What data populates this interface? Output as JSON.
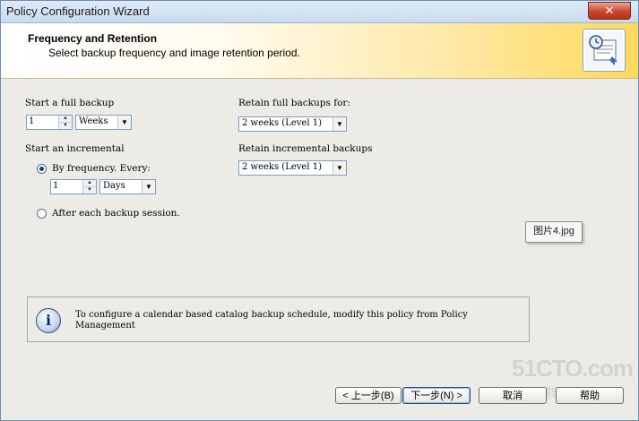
{
  "window": {
    "title": "Policy Configuration Wizard",
    "close_glyph": "✕"
  },
  "banner": {
    "title": "Frequency and Retention",
    "subtitle": "Select backup frequency and image retention period.",
    "icon": "calendar-wizard-icon"
  },
  "full_backup": {
    "label": "Start a full backup",
    "count": "1",
    "unit": "Weeks"
  },
  "retain_full": {
    "label": "Retain full backups for:",
    "value": "2 weeks (Level 1)"
  },
  "incremental": {
    "label": "Start an incremental",
    "by_frequency_label": "By frequency. Every:",
    "by_frequency_selected": true,
    "count": "1",
    "unit": "Days",
    "after_session_label": "After each backup session."
  },
  "retain_incremental": {
    "label": "Retain incremental backups",
    "value": "2 weeks (Level 1)"
  },
  "tooltip": "图片4.jpg",
  "info": {
    "icon": "info-icon",
    "text": "To configure a calendar based catalog backup schedule, modify this policy from Policy Management"
  },
  "buttons": {
    "back": "< 上一步(B)",
    "next": "下一步(N) >",
    "cancel": "取消",
    "help": "帮助"
  },
  "watermark": {
    "line1": "51CTO.com",
    "line2": "技术博客  Blog"
  }
}
